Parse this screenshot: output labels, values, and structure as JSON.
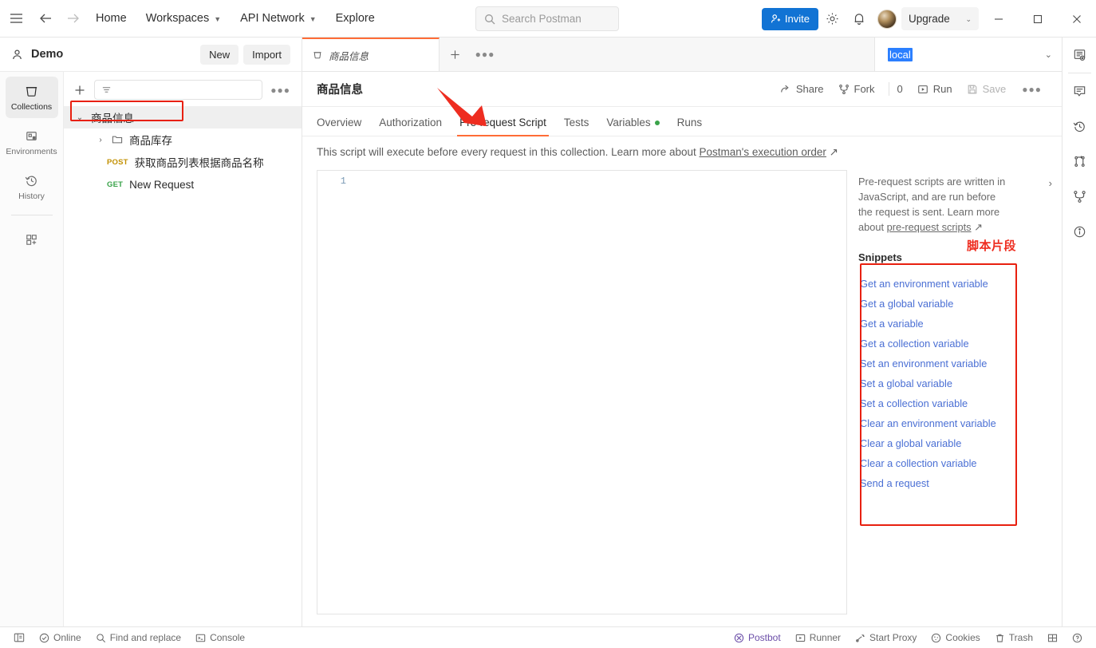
{
  "topbar": {
    "menu_icon": "hamburger-icon",
    "back_icon": "arrow-left-icon",
    "forward_icon": "arrow-right-icon",
    "nav": [
      {
        "label": "Home",
        "has_caret": false
      },
      {
        "label": "Workspaces",
        "has_caret": true
      },
      {
        "label": "API Network",
        "has_caret": true
      },
      {
        "label": "Explore",
        "has_caret": false
      }
    ],
    "search_placeholder": "Search Postman",
    "invite_label": "Invite",
    "settings_icon": "gear-icon",
    "notifications_icon": "bell-icon",
    "avatar_icon": "user-avatar",
    "upgrade_label": "Upgrade",
    "minimize_icon": "minimize-icon",
    "maximize_icon": "maximize-icon",
    "close_icon": "close-icon"
  },
  "workbar": {
    "workspace_name": "Demo",
    "new_label": "New",
    "import_label": "Import"
  },
  "rail": {
    "items": [
      {
        "label": "Collections",
        "icon": "collections-icon",
        "active": true
      },
      {
        "label": "Environments",
        "icon": "environments-icon",
        "active": false
      },
      {
        "label": "History",
        "icon": "history-icon",
        "active": false
      }
    ],
    "add_more_label": "",
    "add_more_icon": "add-apps-icon"
  },
  "sidebar": {
    "add_icon": "plus-icon",
    "filter_icon": "filter-icon",
    "filter_placeholder": "",
    "more_icon": "more-options-icon",
    "tree": [
      {
        "label": "商品信息",
        "type": "collection",
        "expanded": true,
        "depth": 0,
        "selected": true
      },
      {
        "label": "商品库存",
        "type": "folder",
        "expanded": false,
        "depth": 1
      },
      {
        "label": "获取商品列表根据商品名称",
        "type": "request",
        "method": "POST",
        "depth": 1
      },
      {
        "label": "New Request",
        "type": "request",
        "method": "GET",
        "depth": 1
      }
    ]
  },
  "tabstrip": {
    "open_tab": "商品信息",
    "tab_icon": "collection-icon",
    "add_tab_icon": "plus-icon",
    "tab_more_icon": "more-options-icon",
    "environment": "local",
    "env_chevron_icon": "chevron-down-icon",
    "env_preview_icon": "environment-quick-look-icon"
  },
  "collection_header": {
    "title": "商品信息",
    "share_label": "Share",
    "share_icon": "share-icon",
    "fork_label": "Fork",
    "fork_icon": "fork-icon",
    "fork_count": "0",
    "run_label": "Run",
    "run_icon": "play-icon",
    "save_label": "Save",
    "save_icon": "save-icon",
    "more_icon": "more-options-icon"
  },
  "subtabs": [
    {
      "label": "Overview",
      "active": false,
      "dot": false
    },
    {
      "label": "Authorization",
      "active": false,
      "dot": false
    },
    {
      "label": "Pre-request Script",
      "active": true,
      "dot": false
    },
    {
      "label": "Tests",
      "active": false,
      "dot": false
    },
    {
      "label": "Variables",
      "active": false,
      "dot": true
    },
    {
      "label": "Runs",
      "active": false,
      "dot": false
    }
  ],
  "description": {
    "text": "This script will execute before every request in this collection. Learn more about ",
    "link_text": "Postman's execution order",
    "external_icon": "↗"
  },
  "editor": {
    "line_numbers": [
      "1"
    ],
    "content": ""
  },
  "help_pane": {
    "paragraph": "Pre-request scripts are written in JavaScript, and are run before the request is sent. Learn more about ",
    "link_text": "pre-request scripts",
    "external_icon": "↗",
    "collapse_icon": "chevron-right-icon",
    "snippets_title": "Snippets",
    "snippets": [
      "Get an environment variable",
      "Get a global variable",
      "Get a variable",
      "Get a collection variable",
      "Set an environment variable",
      "Set a global variable",
      "Set a collection variable",
      "Clear an environment variable",
      "Clear a global variable",
      "Clear a collection variable",
      "Send a request"
    ]
  },
  "annotations": {
    "snippets_caption": "脚本片段",
    "box_color": "#e8200f",
    "arrow_color": "#ee2d20"
  },
  "right_rail": {
    "items": [
      {
        "icon": "environment-quick-look-icon"
      },
      {
        "icon": "comments-icon"
      },
      {
        "icon": "history-icon"
      },
      {
        "icon": "changelog-icon"
      },
      {
        "icon": "fork-icon"
      },
      {
        "icon": "info-icon"
      }
    ]
  },
  "statusbar": {
    "left": [
      {
        "label": "",
        "icon": "sidebar-toggle-icon"
      },
      {
        "label": "Online",
        "icon": "check-circle-icon"
      },
      {
        "label": "Find and replace",
        "icon": "search-icon"
      },
      {
        "label": "Console",
        "icon": "console-icon"
      }
    ],
    "right": [
      {
        "label": "Postbot",
        "icon": "postbot-icon",
        "accent": "#6b4ea8"
      },
      {
        "label": "Runner",
        "icon": "runner-icon"
      },
      {
        "label": "Start Proxy",
        "icon": "proxy-icon"
      },
      {
        "label": "Cookies",
        "icon": "cookie-icon"
      },
      {
        "label": "Trash",
        "icon": "trash-icon"
      },
      {
        "label": "",
        "icon": "layout-icon"
      },
      {
        "label": "",
        "icon": "help-icon"
      }
    ]
  }
}
